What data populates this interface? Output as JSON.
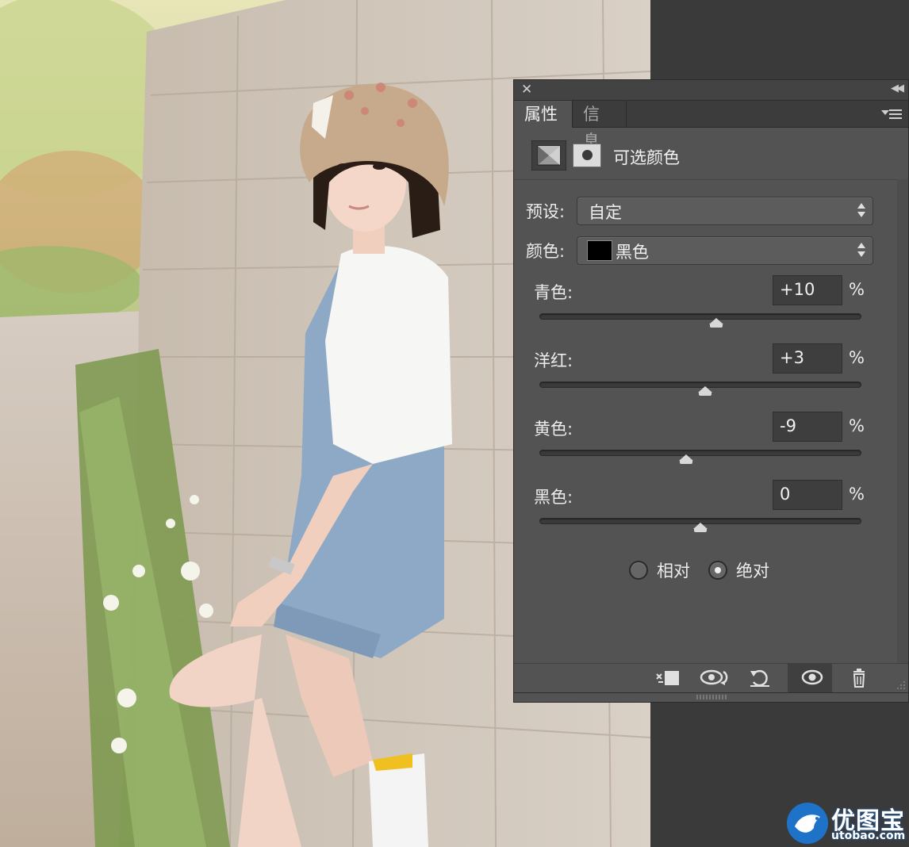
{
  "panel": {
    "tabs": [
      {
        "label": "属性"
      },
      {
        "label": "信息"
      }
    ],
    "adjustment_title": "可选颜色",
    "preset": {
      "label": "预设:",
      "value": "自定"
    },
    "color": {
      "label": "颜色:",
      "value": "黑色",
      "swatch": "#000000"
    },
    "sliders": [
      {
        "label": "青色:",
        "value": "+10",
        "unit": "%",
        "fraction": 0.55
      },
      {
        "label": "洋红:",
        "value": "+3",
        "unit": "%",
        "fraction": 0.515
      },
      {
        "label": "黄色:",
        "value": "-9",
        "unit": "%",
        "fraction": 0.455
      },
      {
        "label": "黑色:",
        "value": "0",
        "unit": "%",
        "fraction": 0.5
      }
    ],
    "method": {
      "relative_label": "相对",
      "absolute_label": "绝对",
      "selected": "absolute"
    }
  },
  "watermark": {
    "text": "优图宝",
    "url": "utobao.com"
  },
  "colors": {
    "panel_bg": "#535353",
    "tab_bar": "#3c3c3c",
    "workspace": "#3a3a3a"
  }
}
